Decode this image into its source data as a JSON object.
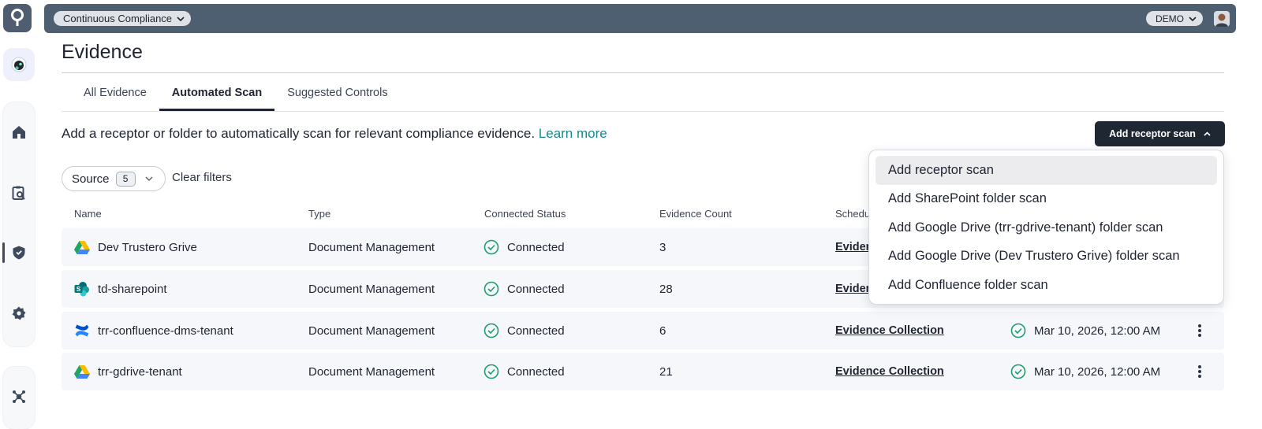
{
  "app": {
    "workspace": "Continuous Compliance",
    "tenant": "DEMO"
  },
  "nav": {
    "items": [
      "home-icon",
      "audit-search-icon",
      "shield-icon",
      "settings-icon",
      "integrations-icon"
    ],
    "active": "shield-icon"
  },
  "page": {
    "title": "Evidence",
    "tabs": [
      "All Evidence",
      "Automated Scan",
      "Suggested Controls"
    ],
    "active_tab": "Automated Scan",
    "description": "Add a receptor or folder to automatically scan for relevant compliance evidence.",
    "learn_more": "Learn more",
    "primary_button": "Add receptor scan"
  },
  "filters": {
    "source_label": "Source",
    "source_count": "5",
    "clear_label": "Clear filters"
  },
  "table": {
    "headers": [
      "Name",
      "Type",
      "Connected Status",
      "Evidence Count",
      "Schedu"
    ],
    "rows": [
      {
        "icon": "google-drive-icon",
        "name": "Dev Trustero Grive",
        "type": "Document Management",
        "status": "Connected",
        "count": "3",
        "schedule": "Eviden",
        "last_scan": "",
        "show_kebab": false
      },
      {
        "icon": "sharepoint-icon",
        "name": "td-sharepoint",
        "type": "Document Management",
        "status": "Connected",
        "count": "28",
        "schedule": "Eviden",
        "last_scan": "",
        "show_kebab": false
      },
      {
        "icon": "confluence-icon",
        "name": "trr-confluence-dms-tenant",
        "type": "Document Management",
        "status": "Connected",
        "count": "6",
        "schedule": "Evidence Collection",
        "last_scan": "Mar 10, 2026, 12:00 AM",
        "show_kebab": true
      },
      {
        "icon": "google-drive-icon",
        "name": "trr-gdrive-tenant",
        "type": "Document Management",
        "status": "Connected",
        "count": "21",
        "schedule": "Evidence Collection",
        "last_scan": "Mar 10, 2026, 12:00 AM",
        "show_kebab": true
      }
    ]
  },
  "menu": {
    "items": [
      "Add receptor scan",
      "Add SharePoint folder scan",
      "Add Google Drive (trr-gdrive-tenant) folder scan",
      "Add Google Drive (Dev Trustero Grive) folder scan",
      "Add Confluence folder scan"
    ],
    "highlighted_index": 0
  },
  "colors": {
    "topbar": "#4f5f72",
    "primary_button": "#1f2733",
    "link": "#158a8f",
    "success": "#1f9d6a"
  }
}
